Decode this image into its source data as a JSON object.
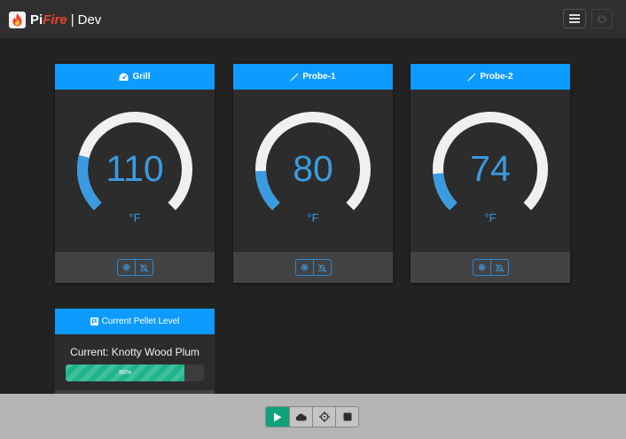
{
  "brand": {
    "pi": "Pi",
    "fire": "Fire",
    "separator": "|",
    "env": "Dev"
  },
  "header": {
    "menu_icon": "hamburger-icon",
    "power_icon": "power-icon"
  },
  "cards": [
    {
      "title": "Grill",
      "icon": "gauge-icon",
      "value": "110",
      "unit": "°F",
      "fraction": 0.22,
      "footer": [
        "gear-icon",
        "notification-off-icon"
      ]
    },
    {
      "title": "Probe-1",
      "icon": "thermometer-icon",
      "value": "80",
      "unit": "°F",
      "fraction": 0.16,
      "footer": [
        "gear-icon",
        "notification-off-icon"
      ]
    },
    {
      "title": "Probe-2",
      "icon": "thermometer-icon",
      "value": "74",
      "unit": "°F",
      "fraction": 0.15,
      "footer": [
        "gear-icon",
        "notification-off-icon"
      ]
    }
  ],
  "pellet": {
    "title": "Current Pellet Level",
    "icon": "flag-icon",
    "current": "Current: Knotty Wood Plum",
    "level_label": "86%",
    "level": 0.86
  },
  "controls": [
    "start-icon",
    "smoke-icon",
    "hold-icon",
    "stop-icon"
  ],
  "colors": {
    "accent": "#0d9bff",
    "gauge": "#3b9be0",
    "track": "#f0f0f0",
    "start": "#10a37a",
    "pellet": "#1fb48a",
    "fire": "#e8452c"
  }
}
